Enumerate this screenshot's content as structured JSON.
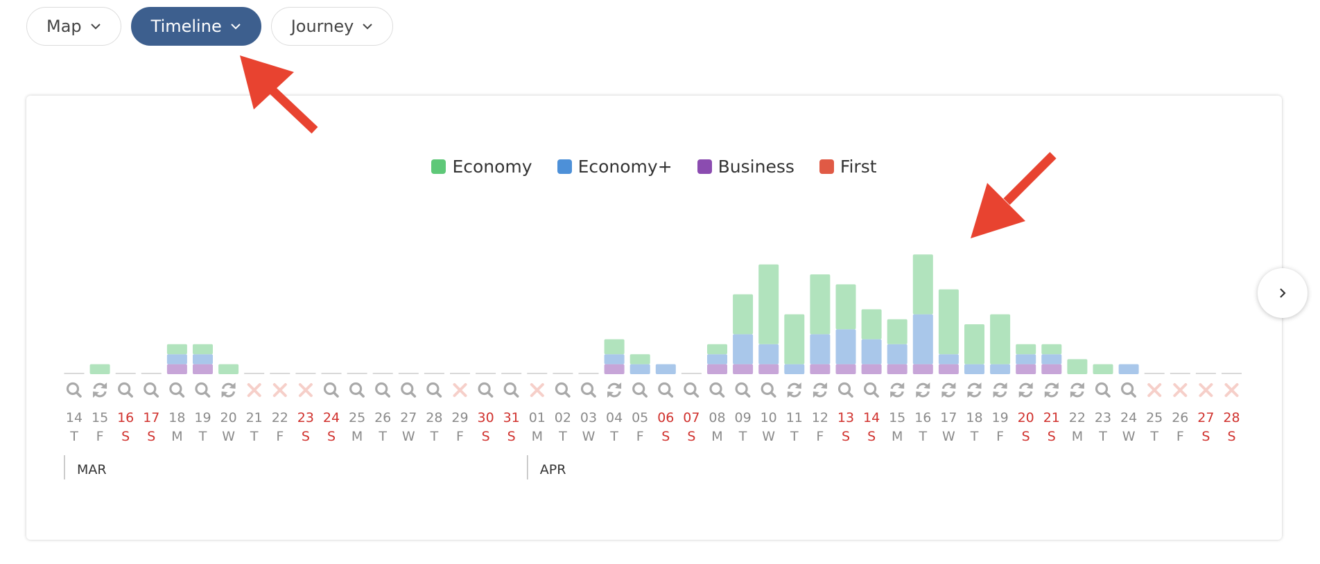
{
  "toolbar": {
    "tabs": [
      {
        "label": "Map",
        "active": false
      },
      {
        "label": "Timeline",
        "active": true
      },
      {
        "label": "Journey",
        "active": false
      }
    ]
  },
  "legend": [
    {
      "label": "Economy",
      "color": "#5ec878"
    },
    {
      "label": "Economy+",
      "color": "#4d90d8"
    },
    {
      "label": "Business",
      "color": "#8b4cb0"
    },
    {
      "label": "First",
      "color": "#e05a45"
    }
  ],
  "colors": {
    "economy_bar": "#b1e3bd",
    "economy_plus_bar": "#a9c7ea",
    "business_bar": "#c7a5d8",
    "weekend_text": "#d0312d",
    "weekday_text": "#8a8a8a",
    "no_flight_icon": "#f6cfc9",
    "icon_gray": "#a9a9a9",
    "arrow": "#e84330"
  },
  "months": [
    {
      "label": "MAR",
      "start_index": 0
    },
    {
      "label": "APR",
      "start_index": 18
    }
  ],
  "chart_data": {
    "type": "bar",
    "stacked": true,
    "categories": [
      "14",
      "15",
      "16",
      "17",
      "18",
      "19",
      "20",
      "21",
      "22",
      "23",
      "24",
      "25",
      "26",
      "27",
      "28",
      "29",
      "30",
      "31",
      "01",
      "02",
      "03",
      "04",
      "05",
      "06",
      "07",
      "08",
      "09",
      "10",
      "11",
      "12",
      "13",
      "14",
      "15",
      "16",
      "17",
      "18",
      "19",
      "20",
      "21",
      "22",
      "23",
      "24",
      "25",
      "26",
      "27",
      "28"
    ],
    "weekdays": [
      "T",
      "F",
      "S",
      "S",
      "M",
      "T",
      "W",
      "T",
      "F",
      "S",
      "S",
      "M",
      "T",
      "W",
      "T",
      "F",
      "S",
      "S",
      "M",
      "T",
      "W",
      "T",
      "F",
      "S",
      "S",
      "M",
      "T",
      "W",
      "T",
      "F",
      "S",
      "S",
      "M",
      "T",
      "W",
      "T",
      "F",
      "S",
      "S",
      "M",
      "T",
      "W",
      "T",
      "F",
      "S",
      "S"
    ],
    "weekend": [
      false,
      false,
      true,
      true,
      false,
      false,
      false,
      false,
      false,
      true,
      true,
      false,
      false,
      false,
      false,
      false,
      true,
      true,
      false,
      false,
      false,
      false,
      false,
      true,
      true,
      false,
      false,
      false,
      false,
      false,
      true,
      true,
      false,
      false,
      false,
      false,
      false,
      true,
      true,
      false,
      false,
      false,
      false,
      false,
      true,
      true
    ],
    "status_icons": [
      "search",
      "refresh",
      "search",
      "search",
      "search",
      "search",
      "refresh",
      "cross",
      "cross",
      "cross",
      "search",
      "search",
      "search",
      "search",
      "search",
      "cross",
      "search",
      "search",
      "cross",
      "search",
      "search",
      "refresh",
      "search",
      "search",
      "search",
      "search",
      "search",
      "search",
      "refresh",
      "refresh",
      "search",
      "search",
      "refresh",
      "refresh",
      "refresh",
      "refresh",
      "refresh",
      "refresh",
      "refresh",
      "refresh",
      "search",
      "search",
      "cross",
      "cross",
      "cross",
      "cross"
    ],
    "series": [
      {
        "name": "Business",
        "values": [
          0,
          0,
          0,
          0,
          1,
          1,
          0,
          0,
          0,
          0,
          0,
          0,
          0,
          0,
          0,
          0,
          0,
          0,
          0,
          0,
          0,
          1,
          0,
          0,
          0,
          1,
          1,
          1,
          0,
          1,
          1,
          1,
          1,
          1,
          1,
          0,
          0,
          1,
          1,
          0,
          0,
          0,
          0,
          0,
          0,
          0
        ]
      },
      {
        "name": "Economy+",
        "values": [
          0,
          0,
          0,
          0,
          1,
          1,
          0,
          0,
          0,
          0,
          0,
          0,
          0,
          0,
          0,
          0,
          0,
          0,
          0,
          0,
          0,
          1,
          1,
          1,
          0,
          1,
          3,
          2,
          1,
          3,
          3.5,
          2.5,
          2,
          5,
          1,
          1,
          1,
          1,
          1,
          0,
          0,
          1,
          0,
          0,
          0,
          0
        ]
      },
      {
        "name": "Economy",
        "values": [
          0,
          1,
          0,
          0,
          1,
          1,
          1,
          0,
          0,
          0,
          0,
          0,
          0,
          0,
          0,
          0,
          0,
          0,
          0,
          0,
          0,
          1.5,
          1,
          0,
          0,
          1,
          4,
          8,
          5,
          6,
          4.5,
          3,
          2.5,
          6,
          6.5,
          4,
          5,
          1,
          1,
          1.5,
          1,
          0,
          0,
          0,
          0,
          0
        ]
      },
      {
        "name": "First",
        "values": [
          0,
          0,
          0,
          0,
          0,
          0,
          0,
          0,
          0,
          0,
          0,
          0,
          0,
          0,
          0,
          0,
          0,
          0,
          0,
          0,
          0,
          0,
          0,
          0,
          0,
          0,
          0,
          0,
          0,
          0,
          0,
          0,
          0,
          0,
          0,
          0,
          0,
          0,
          0,
          0,
          0,
          0,
          0,
          0,
          0,
          0
        ]
      }
    ]
  }
}
